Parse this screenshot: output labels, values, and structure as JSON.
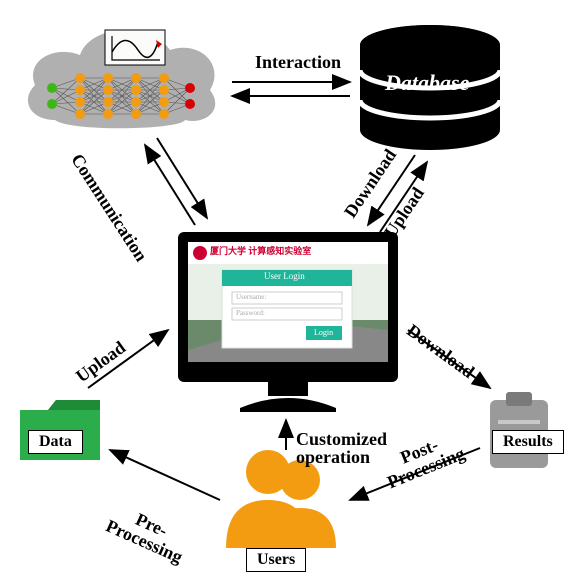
{
  "nodes": {
    "cloud": {
      "name": "cloud-compute"
    },
    "database": {
      "label": "Database"
    },
    "monitor": {
      "login_title": "User Login",
      "username_placeholder": "Username:",
      "password_placeholder": "Password:",
      "login_button": "Login",
      "header_text": "厦门大学 计算感知实验室"
    },
    "data": {
      "label": "Data"
    },
    "results": {
      "label": "Results"
    },
    "users": {
      "label": "Users"
    }
  },
  "edges": {
    "interaction": "Interaction",
    "communication": "Communication",
    "download_upload_db": {
      "down": "Download",
      "up": "Upload"
    },
    "upload_data": "Upload",
    "download_results": "Download",
    "pre_processing": {
      "line1": "Pre-",
      "line2": "Processing"
    },
    "post_processing": {
      "line1": "Post-",
      "line2": "Processing"
    },
    "customized_op": {
      "line1": "Customized",
      "line2": "operation"
    }
  }
}
